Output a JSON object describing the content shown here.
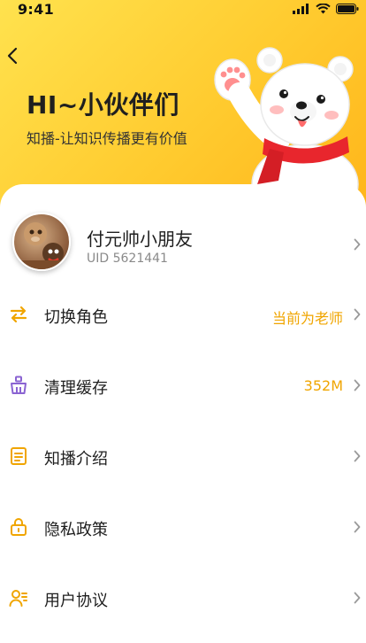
{
  "status": {
    "time": "9:41"
  },
  "hero": {
    "title": "HI~小伙伴们",
    "subtitle": "知播-让知识传播更有价值"
  },
  "profile": {
    "name": "付元帅小朋友",
    "uid": "UID 5621441"
  },
  "menu": [
    {
      "label": "切换角色",
      "value": "当前为老师",
      "icon": "swap-icon"
    },
    {
      "label": "清理缓存",
      "value": "352M",
      "icon": "broom-icon"
    },
    {
      "label": "知播介绍",
      "value": "",
      "icon": "document-icon"
    },
    {
      "label": "隐私政策",
      "value": "",
      "icon": "lock-icon"
    },
    {
      "label": "用户协议",
      "value": "",
      "icon": "user-agreement-icon"
    }
  ],
  "colors": {
    "accent": "#f0a500",
    "swap_icon": "#f0a500",
    "broom_icon": "#8a63d2",
    "doc_icon": "#f0a500",
    "lock_icon": "#f0a500",
    "user_icon": "#f0a500"
  }
}
